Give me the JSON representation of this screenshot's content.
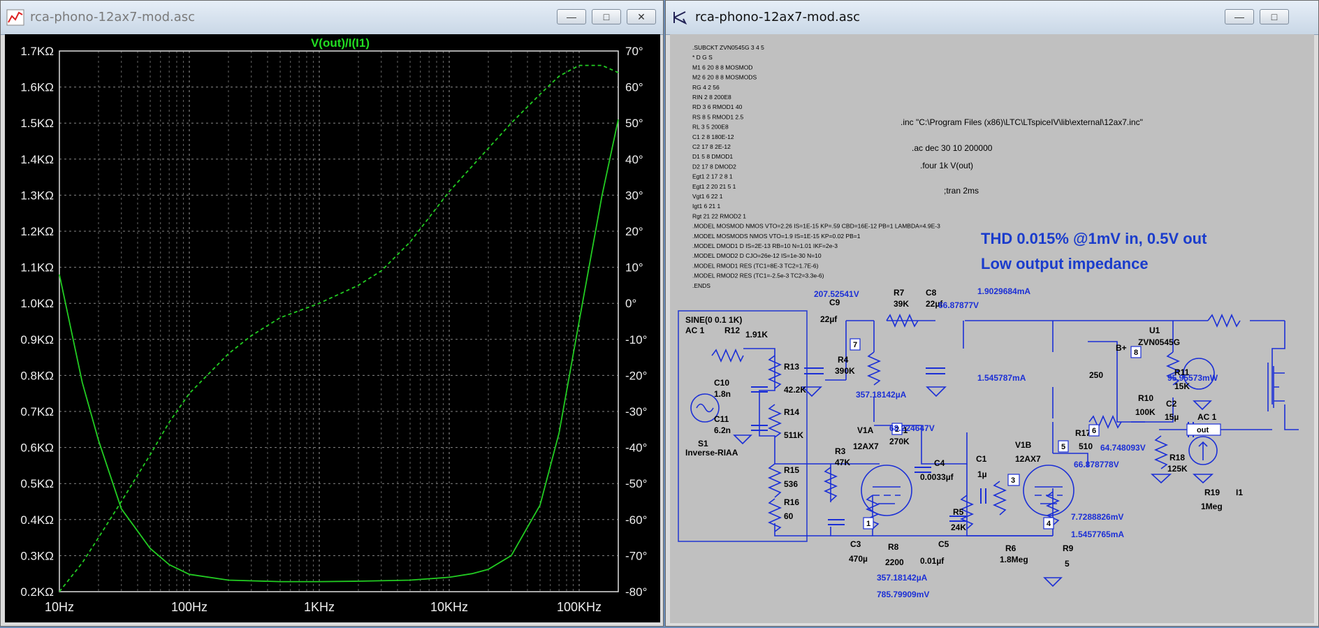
{
  "left_window": {
    "title": "rca-phono-12ax7-mod.asc",
    "buttons": {
      "minimize": "—",
      "maximize": "□",
      "close": "✕"
    },
    "trace_label": "V(out)/I(I1)",
    "icon": "waveform-icon"
  },
  "right_window": {
    "title": "rca-phono-12ax7-mod.asc",
    "buttons": {
      "minimize": "—",
      "maximize": "□"
    },
    "icon": "schematic-icon"
  },
  "chart_data": {
    "type": "line",
    "title": "V(out)/I(I1)",
    "x_scale": "log",
    "x_range": [
      10,
      200000
    ],
    "x_ticks": [
      "10Hz",
      "100Hz",
      "1KHz",
      "10KHz",
      "100KHz"
    ],
    "y_left_range": [
      200,
      1700
    ],
    "y_left_ticks": [
      "1.7KΩ",
      "1.6KΩ",
      "1.5KΩ",
      "1.4KΩ",
      "1.3KΩ",
      "1.2KΩ",
      "1.1KΩ",
      "1.0KΩ",
      "0.9KΩ",
      "0.8KΩ",
      "0.7KΩ",
      "0.6KΩ",
      "0.5KΩ",
      "0.4KΩ",
      "0.3KΩ",
      "0.2KΩ"
    ],
    "y_right_range": [
      -80,
      70
    ],
    "y_right_ticks": [
      "70°",
      "60°",
      "50°",
      "40°",
      "30°",
      "20°",
      "10°",
      "0°",
      "-10°",
      "-20°",
      "-30°",
      "-40°",
      "-50°",
      "-60°",
      "-70°",
      "-80°"
    ],
    "grid": true,
    "series": [
      {
        "style": "solid",
        "unit": "ohm",
        "color": "#22cc22",
        "x": [
          10,
          15,
          20,
          30,
          50,
          70,
          100,
          200,
          500,
          1000,
          2000,
          5000,
          10000,
          15000,
          20000,
          30000,
          50000,
          70000,
          100000,
          150000,
          200000
        ],
        "y": [
          1080,
          780,
          620,
          430,
          320,
          275,
          248,
          232,
          228,
          228,
          229,
          232,
          240,
          250,
          262,
          300,
          440,
          640,
          950,
          1300,
          1510
        ]
      },
      {
        "style": "dashed",
        "unit": "deg",
        "color": "#22cc22",
        "x": [
          10,
          15,
          20,
          30,
          50,
          70,
          100,
          200,
          300,
          500,
          1000,
          2000,
          3000,
          5000,
          10000,
          20000,
          30000,
          50000,
          70000,
          100000,
          150000,
          200000
        ],
        "y": [
          -80,
          -72,
          -65,
          -55,
          -42,
          -33,
          -25,
          -14,
          -9,
          -4,
          0,
          5,
          9,
          17,
          31,
          43,
          50,
          58,
          63,
          66,
          66,
          64
        ]
      }
    ]
  },
  "schematic": {
    "netlist": [
      ".SUBCKT ZVN0545G 3 4 5",
      "* D G S",
      "M1 6 20 8 8 MOSMOD",
      "M2 6 20 8 8 MOSMODS",
      "RG 4 2 56",
      "RIN 2 8 200E8",
      "RD 3 6 RMOD1 40",
      "RS 8 5 RMOD1 2.5",
      "RL 3 5 200E8",
      "C1 2 8 180E-12",
      "C2 17 8 2E-12",
      "D1 5 8 DMOD1",
      "D2 17 8 DMOD2",
      "Egt1 2 17 2 8 1",
      "Egt1 2 20 21 5 1",
      "Vgt1 6 22 1",
      "Igt1 6 21 1",
      "Rgt 21 22 RMOD2 1",
      ".MODEL MOSMOD NMOS VTO=2.26 IS=1E-15 KP=.59 CBD=16E-12 PB=1 LAMBDA=4.9E-3",
      ".MODEL MOSMODS NMOS VTO=1.9 IS=1E-15 KP=0.02 PB=1",
      ".MODEL DMOD1 D IS=2E-13 RB=10 N=1.01 IKF=2e-3",
      ".MODEL DMOD2 D CJO=26e-12 IS=1e-30 N=10",
      ".MODEL RMOD1 RES (TC1=8E-3 TC2=1.7E-6)",
      ".MODEL RMOD2 RES (TC1=-2.5e-3 TC2=3.3e-6)",
      ".ENDS"
    ],
    "directives": {
      "inc": ".inc \"C:\\Program Files (x86)\\LTC\\LTspiceIV\\lib\\external\\12ax7.inc\"",
      "ac": ".ac dec 30 10 200000",
      "four": ".four 1k V(out)",
      "tran": ";tran 2ms"
    },
    "headline1": "THD 0.015% @1mV in, 0.5V out",
    "headline2": "Low output impedance",
    "labels": {
      "src_sine": "SINE(0 0.1 1K)",
      "src_ac": "AC 1",
      "src_name": "S1",
      "r12": "R12",
      "r12v": "1.91K",
      "r13": "R13",
      "r13v": "42.2K",
      "r14": "R14",
      "r14v": "511K",
      "c10": "C10",
      "c10v": "1.8n",
      "c11": "C11",
      "c11v": "6.2n",
      "inverse": "Inverse-RIAA",
      "r15": "R15",
      "r15v": "536",
      "r16": "R16",
      "r16v": "60",
      "c9": "C9",
      "c9v": "22µf",
      "r4": "R4",
      "r4v": "390K",
      "r3": "R3",
      "r3v": "47K",
      "r7": "R7",
      "r7v": "39K",
      "c8": "C8",
      "c8v": "22µf",
      "r1": "R1",
      "r1v": "270K",
      "v1a": "V1A",
      "v1at": "12AX7",
      "c4": "C4",
      "c4v": "0.0033µf",
      "c1": "C1",
      "c1v": "1µ",
      "r5": "R5",
      "r5v": "24K",
      "c5": "C5",
      "c5v": "0.01µf",
      "c3": "C3",
      "c3v": "470µ",
      "r8": "R8",
      "r8v": "2200",
      "r6": "R6",
      "r6v": "1.8Meg",
      "v1b": "V1B",
      "v1bt": "12AX7",
      "r9": "R9",
      "r9v": "5",
      "r10": "R10",
      "r10v": "100K",
      "r11": "R11",
      "r11v": "15K",
      "bplus": "B+",
      "bplusv": "250",
      "u1": "U1",
      "u1t": "ZVN0545G",
      "r17": "R17",
      "r17v": "510",
      "c2": "C2",
      "c2v": "15µ",
      "r18": "R18",
      "r18v": "125K",
      "r19": "R19",
      "r19v": "1Meg",
      "ac1": "AC 1",
      "i1": "I1",
      "out": "out",
      "n8": "8",
      "n7": "7",
      "n2": "2",
      "n5": "5",
      "n6": "6",
      "n3": "3",
      "n4": "4",
      "n1": "1"
    },
    "probes": {
      "p1": "207.52541V",
      "p2": "66.87877V",
      "p3": "1.9029684mA",
      "p4": "357.18142µA",
      "p5": "1.545787mA",
      "p6": "95.95573mW",
      "p7": "68.224647V",
      "p8": "64.748093V",
      "p9": "66.878778V",
      "p10": "7.7288826mV",
      "p11": "1.5457765mA",
      "p12": "357.18142µA",
      "p13": "785.79909mV"
    }
  }
}
